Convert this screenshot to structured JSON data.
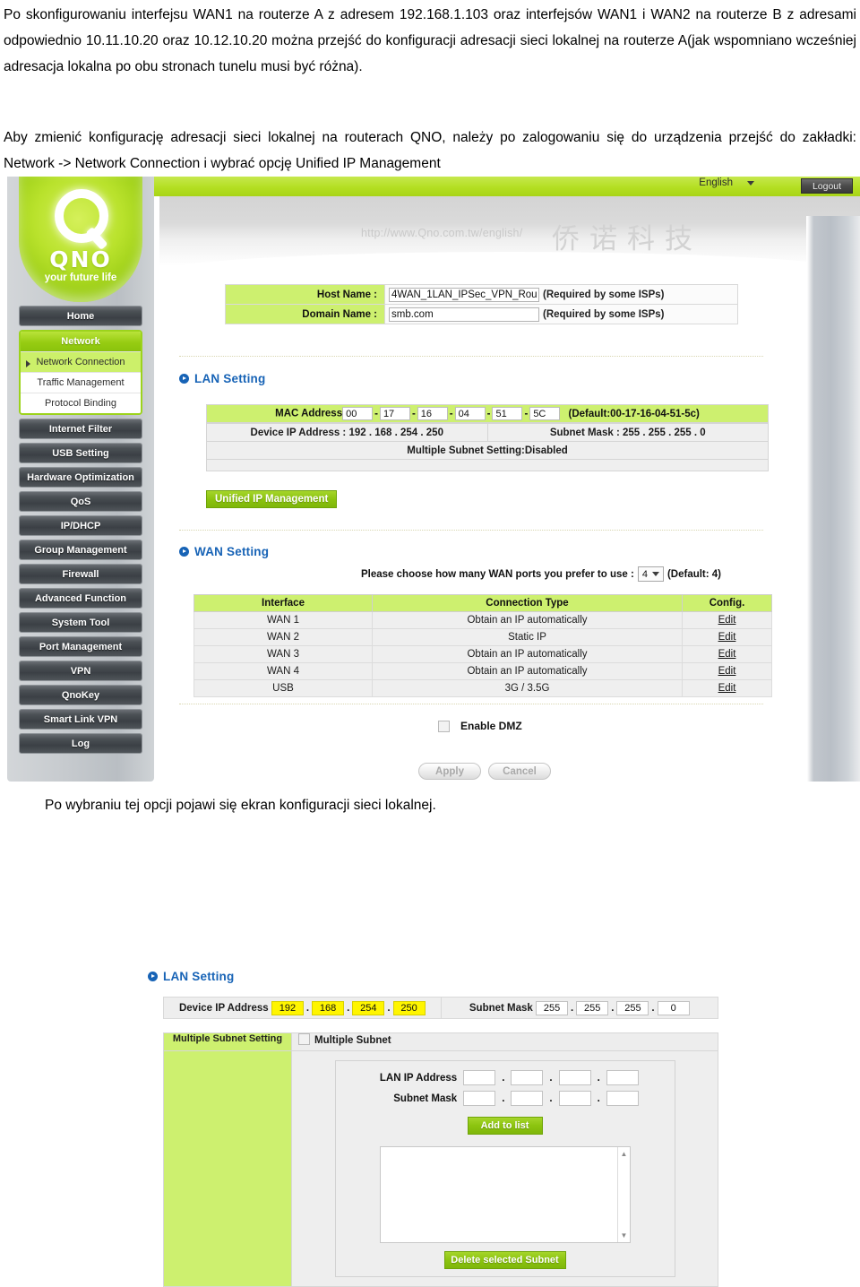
{
  "document": {
    "paragraph1": "Po skonfigurowaniu interfejsu WAN1 na routerze A z adresem 192.168.1.103 oraz interfejsów WAN1 i WAN2 na routerze B z adresami odpowiednio 10.11.10.20 oraz 10.12.10.20  można przejść do konfiguracji adresacji sieci lokalnej na routerze A(jak wspomniano wcześniej adresacja lokalna po obu stronach tunelu musi być różna).",
    "paragraph2": "Aby zmienić konfigurację adresacji sieci lokalnej na routerach QNO, należy po zalogowaniu się do urządzenia przejść do zakładki: Network -> Network Connection i wybrać opcję Unified IP Management",
    "paragraph3": "Po wybraniu tej opcji pojawi się ekran konfiguracji sieci lokalnej."
  },
  "router_ui": {
    "topbar": {
      "language": "English",
      "logout_label": "Logout"
    },
    "branding": {
      "logo_text": "QNO",
      "tagline": "your future life",
      "watermark_url": "http://www.Qno.com.tw/english/",
      "watermark_cjk": "侨诺科技"
    },
    "sidebar": {
      "home": "Home",
      "network_group": {
        "label": "Network",
        "items": [
          {
            "label": "Network Connection",
            "selected": true
          },
          {
            "label": "Traffic Management",
            "selected": false
          },
          {
            "label": "Protocol Binding",
            "selected": false
          }
        ]
      },
      "items": [
        "Internet Filter",
        "USB Setting",
        "Hardware Optimization",
        "QoS",
        "IP/DHCP",
        "Group Management",
        "Firewall",
        "Advanced Function",
        "System Tool",
        "Port Management",
        "VPN",
        "QnoKey",
        "Smart Link VPN",
        "Log"
      ]
    },
    "host_fields": [
      {
        "label": "Host Name :",
        "value": "4WAN_1LAN_IPSec_VPN_Rou",
        "hint": "(Required by some ISPs)"
      },
      {
        "label": "Domain Name :",
        "value": "smb.com",
        "hint": "(Required by some ISPs)"
      }
    ],
    "lan_setting": {
      "title": "LAN Setting",
      "mac_label": "MAC Address",
      "mac_octets": [
        "00",
        "17",
        "16",
        "04",
        "51",
        "5C"
      ],
      "mac_default": "(Default:00-17-16-04-51-5c)",
      "device_ip_text": "Device IP Address : 192 . 168 . 254 . 250",
      "subnet_mask_text": "Subnet Mask : 255 . 255 . 255 . 0",
      "multiple_subnet_text": "Multiple Subnet Setting:Disabled",
      "unified_ip_button": "Unified IP Management"
    },
    "wan_setting": {
      "title": "WAN Setting",
      "choose_label": "Please choose how many WAN ports you prefer to use :",
      "port_count": "4",
      "default_hint": "(Default: 4)",
      "columns": [
        "Interface",
        "Connection Type",
        "Config."
      ],
      "rows": [
        {
          "interface": "WAN 1",
          "type": "Obtain an IP automatically",
          "config": "Edit"
        },
        {
          "interface": "WAN 2",
          "type": "Static IP",
          "config": "Edit"
        },
        {
          "interface": "WAN 3",
          "type": "Obtain an IP automatically",
          "config": "Edit"
        },
        {
          "interface": "WAN 4",
          "type": "Obtain an IP automatically",
          "config": "Edit"
        },
        {
          "interface": "USB",
          "type": "3G / 3.5G",
          "config": "Edit"
        }
      ],
      "dmz_label": "Enable DMZ",
      "apply_label": "Apply",
      "cancel_label": "Cancel"
    }
  },
  "lan_config_screen": {
    "title": "LAN Setting",
    "device_ip_label": "Device IP Address",
    "device_ip_octets": [
      "192",
      "168",
      "254",
      "250"
    ],
    "subnet_mask_label": "Subnet Mask",
    "subnet_mask_octets": [
      "255",
      "255",
      "255",
      "0"
    ],
    "multiple_subnet_setting_label": "Multiple Subnet Setting",
    "multiple_subnet_checkbox_label": "Multiple Subnet",
    "lan_ip_address_label": "LAN IP Address",
    "subnet_mask_field_label": "Subnet Mask",
    "add_to_list_label": "Add to list",
    "delete_selected_subnet_label": "Delete selected Subnet"
  },
  "colors": {
    "brand_green": "#9ccc14",
    "light_green": "#cdf06f",
    "section_blue": "#1763b6",
    "highlight_yellow": "#fff500"
  }
}
